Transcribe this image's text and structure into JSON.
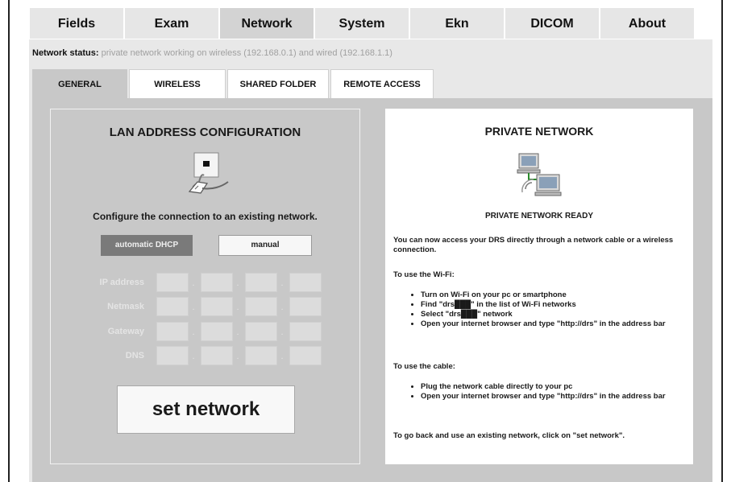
{
  "main_tabs": [
    "Fields",
    "Exam",
    "Network",
    "System",
    "Ekn",
    "DICOM",
    "About"
  ],
  "active_main_tab": "Network",
  "network_status": {
    "label": "Network status:",
    "value": "private network working on wireless (192.168.0.1) and wired (192.168.1.1)"
  },
  "sub_tabs": [
    "GENERAL",
    "WIRELESS",
    "SHARED FOLDER",
    "REMOTE ACCESS"
  ],
  "active_sub_tab": "GENERAL",
  "lan": {
    "title": "LAN ADDRESS CONFIGURATION",
    "description": "Configure the connection to an existing network.",
    "dhcp_label": "automatic DHCP",
    "manual_label": "manual",
    "fields": [
      "IP address",
      "Netmask",
      "Gateway",
      "DNS"
    ],
    "dot": ".",
    "set_button": "set network"
  },
  "private_network": {
    "title": "PRIVATE NETWORK",
    "status": "PRIVATE NETWORK READY",
    "intro": "You can now access your DRS directly through a network cable or a wireless connection.",
    "wifi_heading": "To use the Wi-Fi:",
    "wifi_steps": [
      "Turn on Wi-Fi on your pc or smartphone",
      "Find \"drs███\" in the list of Wi-Fi networks",
      "Select \"drs███\" network",
      "Open your internet browser and type \"http://drs\" in the address bar"
    ],
    "cable_heading": "To use the cable:",
    "cable_steps": [
      "Plug the network cable directly to your pc",
      "Open your internet browser and type \"http://drs\" in the address bar"
    ],
    "footer": "To go back and use an existing network, click on \"set network\"."
  }
}
